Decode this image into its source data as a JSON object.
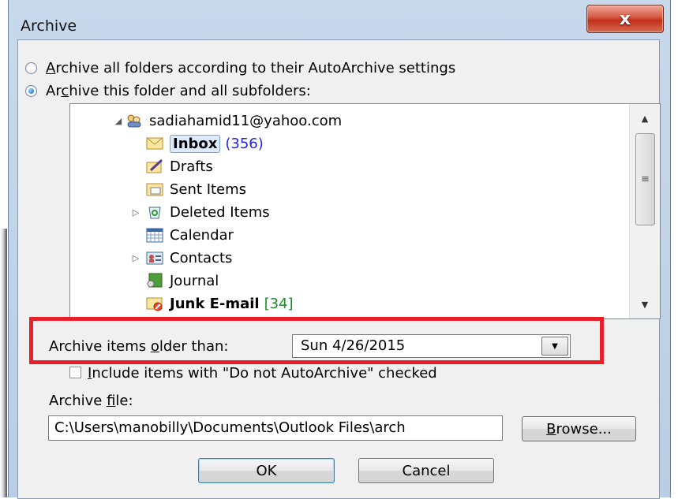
{
  "window": {
    "title": "Archive",
    "close_glyph": "x"
  },
  "options": {
    "all_folders_label": "Archive all folders according to their AutoArchive settings",
    "this_folder_label": "Archive this folder and all subfolders:",
    "selected": "this_folder"
  },
  "tree": {
    "account": "sadiahamid11@yahoo.com",
    "items": [
      {
        "label": "Inbox",
        "count": "(356)",
        "icon": "inbox-icon",
        "selected": true
      },
      {
        "label": "Drafts",
        "count": "",
        "icon": "drafts-icon"
      },
      {
        "label": "Sent Items",
        "count": "",
        "icon": "sent-items-icon"
      },
      {
        "label": "Deleted Items",
        "count": "",
        "icon": "deleted-items-icon",
        "expandable": true
      },
      {
        "label": "Calendar",
        "count": "",
        "icon": "calendar-icon"
      },
      {
        "label": "Contacts",
        "count": "",
        "icon": "contacts-icon",
        "expandable": true
      },
      {
        "label": "Journal",
        "count": "",
        "icon": "journal-icon"
      },
      {
        "label": "Junk E-mail",
        "count": "[34]",
        "icon": "junk-email-icon"
      }
    ]
  },
  "older_than": {
    "label": "Archive items older than:",
    "value": "Sun 4/26/2015"
  },
  "include_checkbox": {
    "label": "Include items with \"Do not AutoArchive\" checked",
    "checked": false
  },
  "archive_file": {
    "label": "Archive file:",
    "value": "C:\\Users\\manobilly\\Documents\\Outlook Files\\arch"
  },
  "buttons": {
    "browse": "Browse...",
    "ok": "OK",
    "cancel": "Cancel"
  },
  "colors": {
    "highlight_box": "#e8202a",
    "unread_count": "#2323e6",
    "junk_count": "#1e8a2a"
  }
}
